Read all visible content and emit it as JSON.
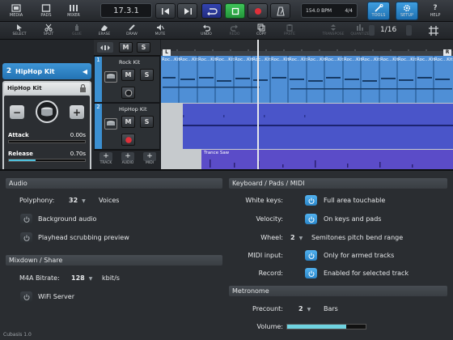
{
  "topbar": {
    "media_label": "MEDIA",
    "pads_label": "PADS",
    "mixer_label": "MIXER",
    "position": "17.3.1",
    "tempo": "154.0 BPM",
    "signature": "4/4",
    "tools_label": "TOOLS",
    "setup_label": "SETUP",
    "help_label": "HELP"
  },
  "toolbar2": {
    "select": "SELECT",
    "split": "SPLIT",
    "glue": "GLUE",
    "erase": "ERASE",
    "draw": "DRAW",
    "mute": "MUTE",
    "undo": "UNDO",
    "redo": "REDO",
    "copy": "COPY",
    "paste": "PASTE",
    "transpose": "TRANSPOSE",
    "quantize": "QUANTIZE",
    "quantize_value": "1/16"
  },
  "inspector": {
    "track_number": "2",
    "track_name": "HipHop Kit",
    "instrument_name": "HipHop Kit",
    "attack_label": "Attack",
    "attack_value": "0.00s",
    "release_label": "Release",
    "release_value": "0.70s",
    "release_level": 0.35
  },
  "tracks": [
    {
      "number": "1",
      "name": "Rock Kit",
      "mute": "M",
      "solo": "S"
    },
    {
      "number": "2",
      "name": "HipHop Kit",
      "mute": "M",
      "solo": "S"
    }
  ],
  "track_list_buttons": {
    "header_mute": "M",
    "header_solo": "S",
    "track": "TRACK",
    "audio": "AUDIO",
    "midi": "MIDI"
  },
  "ruler_markers": {
    "left": "L",
    "right": "R"
  },
  "regions": {
    "rock_label": "Roc...Kit",
    "trance_label": "Trance Saw"
  },
  "audio": {
    "title": "Audio",
    "polyphony_label": "Polyphony:",
    "polyphony_value": "32",
    "polyphony_unit": "Voices",
    "background_audio": "Background audio",
    "playhead_scrubbing": "Playhead scrubbing preview"
  },
  "mixdown": {
    "title": "Mixdown / Share",
    "bitrate_label": "M4A Bitrate:",
    "bitrate_value": "128",
    "bitrate_unit": "kbit/s",
    "wifi_server": "WiFi Server"
  },
  "keyboard": {
    "title": "Keyboard / Pads / MIDI",
    "white_keys_label": "White keys:",
    "white_keys_value": "Full area touchable",
    "velocity_label": "Velocity:",
    "velocity_value": "On keys and pads",
    "wheel_label": "Wheel:",
    "wheel_number": "2",
    "wheel_value": "Semitones pitch bend range",
    "midi_input_label": "MIDI input:",
    "midi_input_value": "Only for armed tracks",
    "record_label": "Record:",
    "record_value": "Enabled for selected track"
  },
  "metronome": {
    "title": "Metronome",
    "precount_label": "Precount:",
    "precount_value": "2",
    "precount_unit": "Bars",
    "volume_label": "Volume:",
    "volume_level": 0.75
  },
  "footer": {
    "version": "Cubasis 1.0"
  },
  "colors": {
    "accent_blue": "#3b8fd1",
    "region_blue": "#4f8fd6",
    "region_indigo": "#4a55c9",
    "region_purple": "#5b4cc8",
    "record_red": "#e0303a",
    "stop_green": "#32b04a",
    "loop_blue": "#2b3a9a"
  }
}
